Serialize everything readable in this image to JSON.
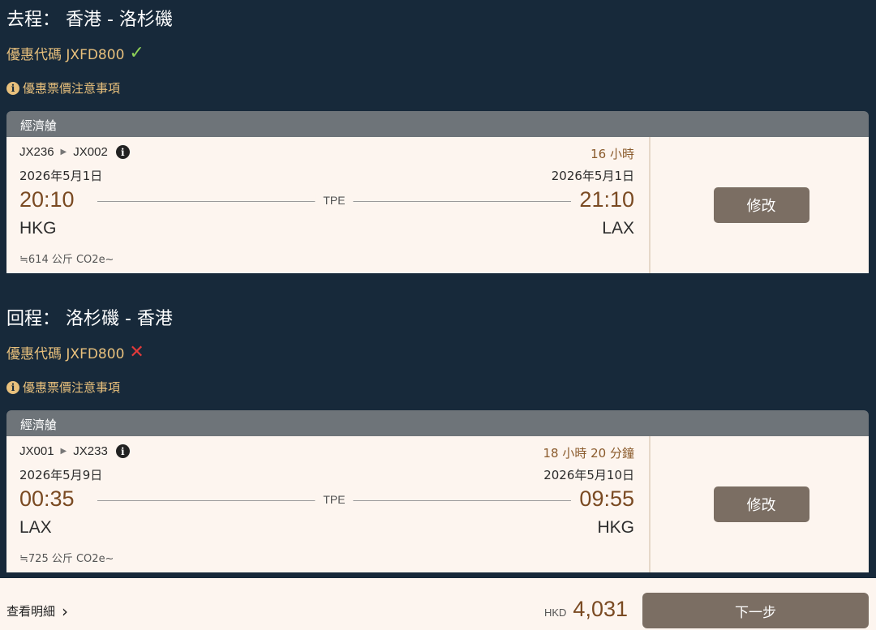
{
  "outbound": {
    "title": "去程： 香港 - 洛杉磯",
    "promo_text": "優惠代碼 JXFD800",
    "promo_status": "valid",
    "notice": "優惠票價注意事項",
    "cabin": "經濟艙",
    "flight1": "JX236",
    "flight2": "JX002",
    "duration": "16 小時",
    "dep_date": "2026年5月1日",
    "arr_date": "2026年5月1日",
    "dep_time": "20:10",
    "arr_time": "21:10",
    "via": "TPE",
    "dep_code": "HKG",
    "arr_code": "LAX",
    "co2": "≒614 公斤 CO2e~",
    "edit_label": "修改"
  },
  "inbound": {
    "title": "回程： 洛杉磯 - 香港",
    "promo_text": "優惠代碼 JXFD800",
    "promo_status": "invalid",
    "notice": "優惠票價注意事項",
    "cabin": "經濟艙",
    "flight1": "JX001",
    "flight2": "JX233",
    "duration": "18 小時 20 分鐘",
    "dep_date": "2026年5月9日",
    "arr_date": "2026年5月10日",
    "dep_time": "00:35",
    "arr_time": "09:55",
    "via": "TPE",
    "dep_code": "LAX",
    "arr_code": "HKG",
    "co2": "≒725 公斤 CO2e~",
    "edit_label": "修改"
  },
  "footer": {
    "details_label": "查看明細",
    "currency": "HKD",
    "amount": "4,031",
    "next_label": "下一步"
  },
  "colors": {
    "background": "#17293a",
    "accent_gold": "#e8c07c",
    "valid_green": "#8ed157",
    "invalid_red": "#e23a3a",
    "button_brown": "#7b6e63",
    "card_bg": "#fdf5ef"
  }
}
